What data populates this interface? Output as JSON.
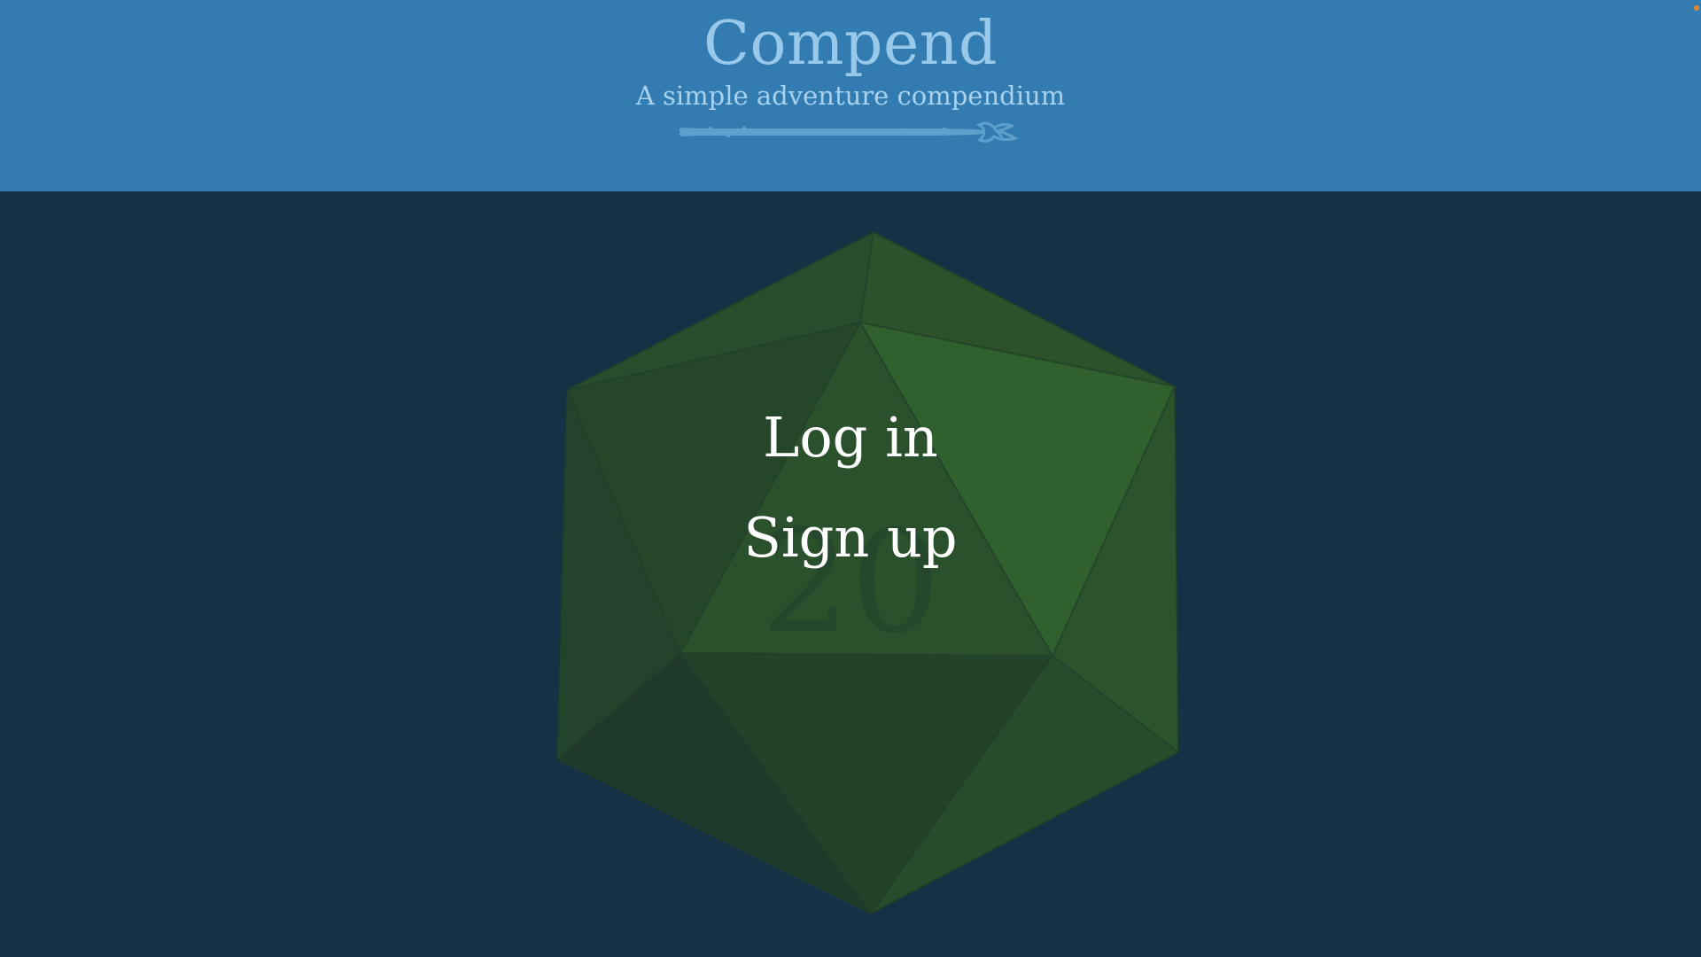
{
  "header": {
    "title": "Compend",
    "subtitle": "A simple adventure compendium",
    "divider_icon": "sword-icon"
  },
  "hero": {
    "die_icon": "d20-icon",
    "die_number": "20"
  },
  "nav": {
    "login_label": "Log in",
    "signup_label": "Sign up"
  },
  "colors": {
    "header_bg": "#337cb1",
    "page_bg": "#163046",
    "title": "#98c8ea",
    "die_green": "#2e5a2c",
    "link_text": "#ffffff"
  }
}
